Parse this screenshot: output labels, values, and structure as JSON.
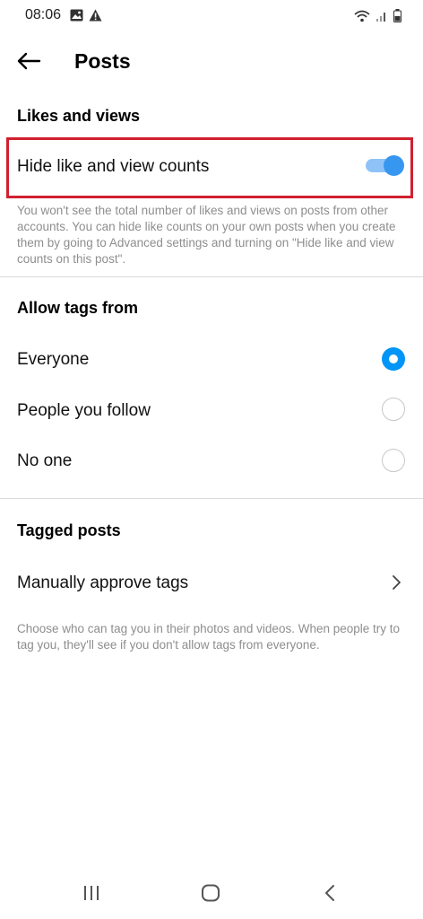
{
  "status_bar": {
    "time": "08:06"
  },
  "header": {
    "title": "Posts"
  },
  "likes_section": {
    "title": "Likes and views",
    "toggle_label": "Hide like and view counts",
    "toggle_on": true,
    "description": "You won't see the total number of likes and views on posts from other accounts. You can hide like counts on your own posts when you create them by going to Advanced settings and turning on \"Hide like and view counts on this post\"."
  },
  "tags_section": {
    "title": "Allow tags from",
    "options": [
      "Everyone",
      "People you follow",
      "No one"
    ],
    "selected": "Everyone"
  },
  "tagged_section": {
    "title": "Tagged posts",
    "manual_label": "Manually approve tags",
    "description": "Choose who can tag you in their photos and videos. When people try to tag you, they'll see if you don't allow tags from everyone."
  },
  "colors": {
    "accent": "#0095f6",
    "highlight": "#d0202f",
    "muted_text": "#8e8e8e",
    "divider": "#dbdbdb"
  }
}
